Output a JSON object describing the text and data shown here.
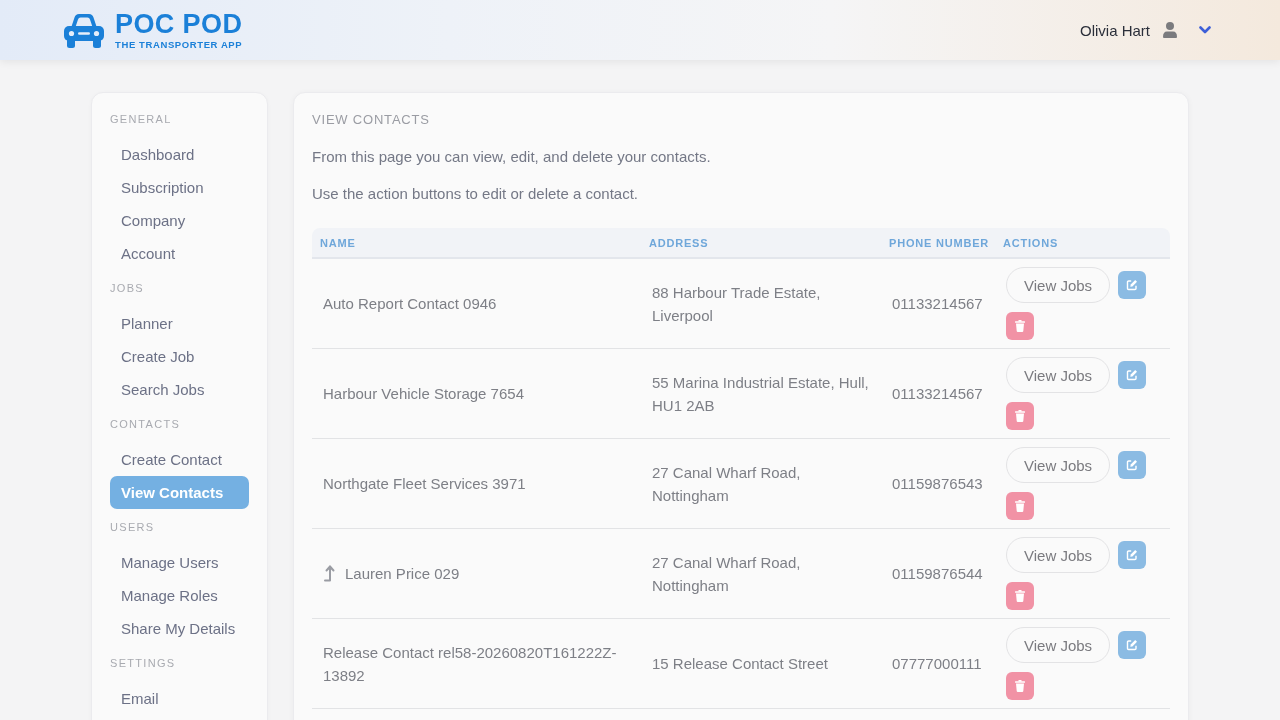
{
  "header": {
    "logo": {
      "title": "POC POD",
      "tagline": "THE TRANSPORTER APP"
    },
    "user": {
      "name": "Olivia Hart"
    }
  },
  "sidebar": {
    "sections": [
      {
        "label": "GENERAL",
        "items": [
          {
            "label": "Dashboard",
            "selected": false
          },
          {
            "label": "Subscription",
            "selected": false
          },
          {
            "label": "Company",
            "selected": false
          },
          {
            "label": "Account",
            "selected": false
          }
        ]
      },
      {
        "label": "JOBS",
        "items": [
          {
            "label": "Planner",
            "selected": false
          },
          {
            "label": "Create Job",
            "selected": false
          },
          {
            "label": "Search Jobs",
            "selected": false
          }
        ]
      },
      {
        "label": "CONTACTS",
        "items": [
          {
            "label": "Create Contact",
            "selected": false
          },
          {
            "label": "View Contacts",
            "selected": true
          }
        ]
      },
      {
        "label": "USERS",
        "items": [
          {
            "label": "Manage Users",
            "selected": false
          },
          {
            "label": "Manage Roles",
            "selected": false
          },
          {
            "label": "Share My Details",
            "selected": false
          }
        ]
      },
      {
        "label": "SETTINGS",
        "items": [
          {
            "label": "Email",
            "selected": false
          }
        ]
      }
    ]
  },
  "page": {
    "title": "VIEW CONTACTS",
    "paragraphs": [
      "From this page you can view, edit, and delete your contacts.",
      "Use the action buttons to edit or delete a contact."
    ]
  },
  "table": {
    "columns": [
      "NAME",
      "ADDRESS",
      "PHONE NUMBER",
      "ACTIONS"
    ],
    "rows": [
      {
        "kind": "plain",
        "name": "Auto Report Contact 0946",
        "address": "88 Harbour Trade Estate, Liverpool",
        "phone": "01133214567",
        "action": "View Jobs"
      },
      {
        "kind": "plain",
        "name": "Harbour Vehicle Storage 7654",
        "address": "55 Marina Industrial Estate, Hull, HU1 2AB",
        "phone": "01133214567",
        "action": "View Jobs"
      },
      {
        "kind": "plain",
        "name": "Northgate Fleet Services 3971",
        "address": "27 Canal Wharf Road, Nottingham",
        "phone": "01159876543",
        "action": "View Jobs"
      },
      {
        "kind": "arrow",
        "name": "Lauren Price 029",
        "address": "27 Canal Wharf Road, Nottingham",
        "phone": "01159876544",
        "action": "View Jobs"
      },
      {
        "kind": "plain",
        "name": "Release Contact rel58-20260820T161222Z-13892",
        "address": "15 Release Contact Street",
        "phone": "07777000111",
        "action": "View Jobs"
      }
    ]
  }
}
